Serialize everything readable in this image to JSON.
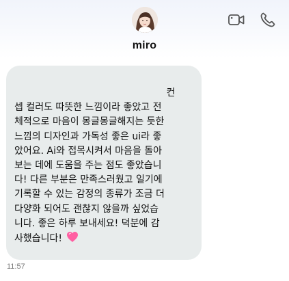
{
  "header": {
    "contact_name": "miro",
    "video_call_icon": "video-camera-icon",
    "voice_call_icon": "phone-icon"
  },
  "message": {
    "lines": [
      "                                                  컨",
      "셉 컬러도 따뜻한 느낌이라 좋았고 전",
      "체적으로 마음이 몽글몽글해지는 듯한",
      "느낌의 디자인과 가독성 좋은 ui라 좋",
      "았어요. Ai와 접목시켜서 마음을 돌아",
      "보는 데에 도움을 주는 점도 좋았습니",
      "다! 다른 부분은 만족스러웠고 일기에",
      "기록할 수 있는 감정의 종류가 조금 더",
      "다양화 되어도 괜찮지 않을까 싶었습",
      "니다. 좋은 하루 보내세요! 덕분에 감",
      "사했습니다!"
    ],
    "emoji": "💗",
    "emoji_icon": "sparkling-heart-icon",
    "timestamp": "11:57"
  },
  "colors": {
    "bubble_bg": "#e8ecec",
    "heart": "#ff5fa2",
    "icon_stroke": "#555555"
  }
}
